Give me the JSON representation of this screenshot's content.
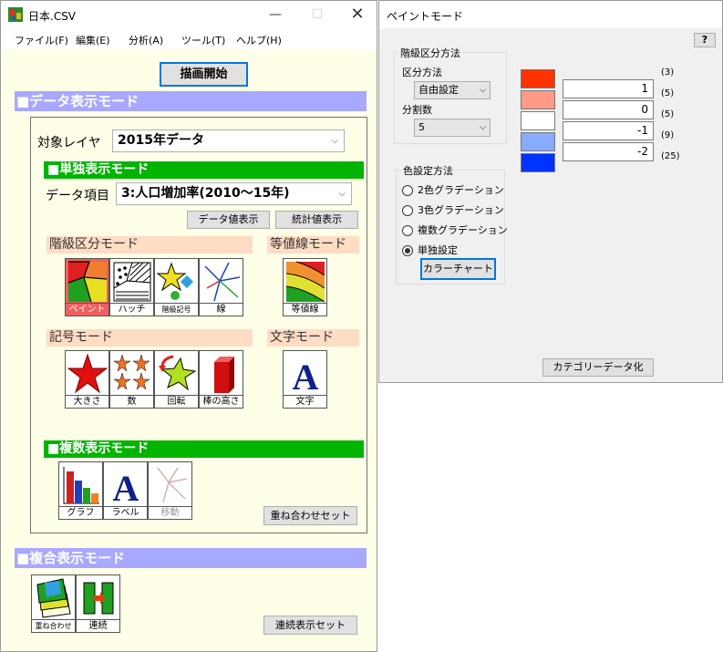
{
  "main_window": {
    "title": "日本.CSV",
    "menu": [
      "ファイル(F)",
      "編集(E)",
      "分析(A)",
      "ツール(T)",
      "ヘルプ(H)"
    ],
    "draw_start_button": "描画開始",
    "data_display_mode": "■データ表示モード",
    "target_layer_label": "対象レイヤ",
    "target_layer_value": "2015年データ",
    "single_display_mode": "■単独表示モード",
    "data_item_label": "データ項目",
    "data_item_value": "3:人口増加率(2010～15年)",
    "data_value_button": "データ値表示",
    "stats_button": "統計値表示",
    "class_mode_label": "階級区分モード",
    "contour_mode_label": "等値線モード",
    "class_icons": [
      "ペイント",
      "ハッチ",
      "階級記号",
      "線"
    ],
    "contour_icon": "等値線",
    "symbol_mode_label": "記号モード",
    "text_mode_label": "文字モード",
    "symbol_icons": [
      "大きさ",
      "数",
      "回転",
      "棒の高さ"
    ],
    "text_icon": "文字",
    "multi_display_mode": "■複数表示モード",
    "multi_icons": [
      "グラフ",
      "ラベル",
      "移動"
    ],
    "overlay_set_button": "重ね合わせセット",
    "composite_display_mode": "■複合表示モード",
    "composite_icons": [
      "重ね合わせ",
      "連続"
    ],
    "continuous_set_button": "連続表示セット"
  },
  "paint_window": {
    "title": "ペイントモード",
    "help_button": "?",
    "class_method_group": "階級区分方法",
    "division_method_label": "区分方法",
    "division_method_value": "自由設定",
    "division_count_label": "分割数",
    "division_count_value": "5",
    "color_method_group": "色設定方法",
    "radios": [
      {
        "label": "2色グラデーション",
        "selected": false
      },
      {
        "label": "3色グラデーション",
        "selected": false
      },
      {
        "label": "複数グラデーション",
        "selected": false
      },
      {
        "label": "単独設定",
        "selected": true
      }
    ],
    "color_chart_button": "カラーチャート",
    "class_colors": [
      "#ff3300",
      "#ff9988",
      "#ffffff",
      "#88aaff",
      "#0033ff"
    ],
    "thresholds": [
      "1",
      "0",
      "-1",
      "-2"
    ],
    "counts": [
      "(3)",
      "(5)",
      "(5)",
      "(9)",
      "(25)"
    ],
    "categorize_button": "カテゴリーデータ化"
  }
}
